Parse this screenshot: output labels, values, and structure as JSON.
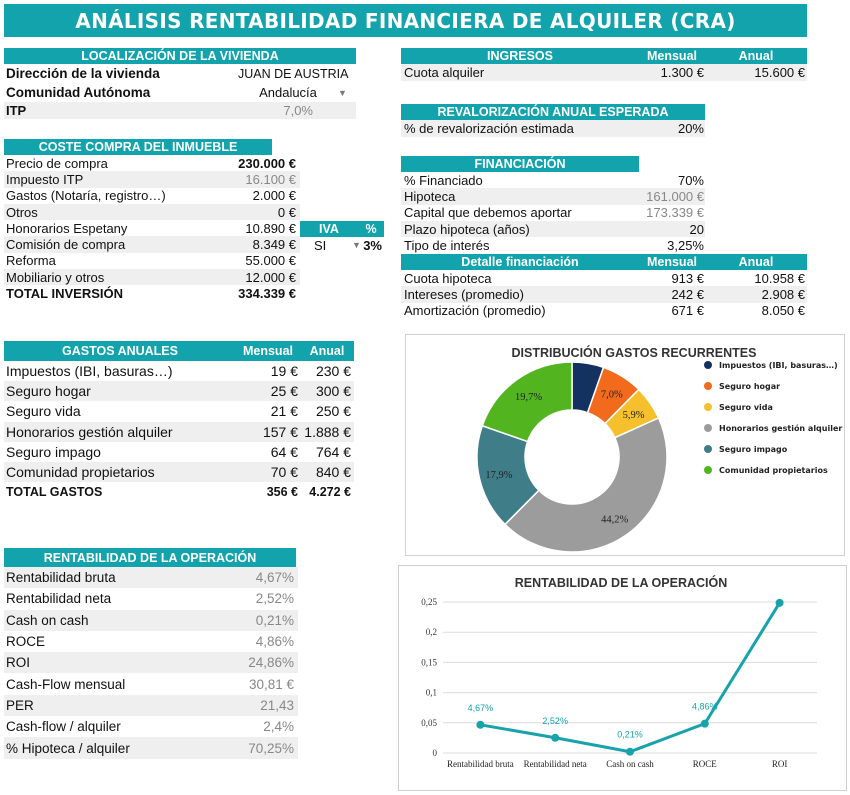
{
  "title": "ANÁLISIS RENTABILIDAD FINANCIERA DE ALQUILER (CRA)",
  "localizacion": {
    "header": "LOCALIZACIÓN DE LA VIVIENDA",
    "rows": [
      {
        "label": "Dirección de la vivienda",
        "value": "JUAN DE AUSTRIA"
      },
      {
        "label": "Comunidad Autónoma",
        "value": "Andalucía"
      },
      {
        "label": "ITP",
        "value": "7,0%"
      }
    ],
    "dropdown_icon": "dropdown-arrow-icon"
  },
  "coste": {
    "header": "COSTE COMPRA DEL INMUEBLE",
    "rows": [
      {
        "label": "Precio de compra",
        "value": "230.000 €"
      },
      {
        "label": "Impuesto ITP",
        "value": "16.100 €"
      },
      {
        "label": "Gastos (Notaría, registro…)",
        "value": "2.000 €"
      },
      {
        "label": "Otros",
        "value": "0 €"
      },
      {
        "label": "Honorarios Espetany",
        "value": "10.890 €"
      },
      {
        "label": "Comisión de compra",
        "value": "8.349 €"
      },
      {
        "label": "Reforma",
        "value": "55.000 €"
      },
      {
        "label": "Mobiliario y otros",
        "value": "12.000 €"
      },
      {
        "label": "TOTAL INVERSIÓN",
        "value": "334.339 €"
      }
    ],
    "iva_header": "IVA",
    "pct_header": "%",
    "iva_value": "SI",
    "pct_value": "3%"
  },
  "ingresos": {
    "header": "INGRESOS",
    "col_mensual": "Mensual",
    "col_anual": "Anual",
    "rows": [
      {
        "label": "Cuota alquiler",
        "mensual": "1.300 €",
        "anual": "15.600 €"
      }
    ]
  },
  "revalorizacion": {
    "header": "REVALORIZACIÓN ANUAL ESPERADA",
    "label": "% de revalorización estimada",
    "value": "20%"
  },
  "financiacion": {
    "header": "FINANCIACIÓN",
    "rows": [
      {
        "label": "% Financiado",
        "value": "70%"
      },
      {
        "label": "Hipoteca",
        "value": "161.000 €"
      },
      {
        "label": "Capital que debemos aportar",
        "value": "173.339 €"
      },
      {
        "label": "Plazo hipoteca (años)",
        "value": "20"
      },
      {
        "label": "Tipo de interés",
        "value": "3,25%"
      }
    ]
  },
  "detalle": {
    "header": "Detalle financiación",
    "col_mensual": "Mensual",
    "col_anual": "Anual",
    "rows": [
      {
        "label": "Cuota hipoteca",
        "mensual": "913 €",
        "anual": "10.958 €"
      },
      {
        "label": "Intereses (promedio)",
        "mensual": "242 €",
        "anual": "2.908 €"
      },
      {
        "label": "Amortización (promedio)",
        "mensual": "671 €",
        "anual": "8.050 €"
      }
    ]
  },
  "gastos": {
    "header": "GASTOS ANUALES",
    "col_mensual": "Mensual",
    "col_anual": "Anual",
    "rows": [
      {
        "label": "Impuestos (IBI, basuras…)",
        "mensual": "19 €",
        "anual": "230 €"
      },
      {
        "label": "Seguro hogar",
        "mensual": "25 €",
        "anual": "300 €"
      },
      {
        "label": "Seguro vida",
        "mensual": "21 €",
        "anual": "250 €"
      },
      {
        "label": "Honorarios gestión alquiler",
        "mensual": "157 €",
        "anual": "1.888 €"
      },
      {
        "label": "Seguro impago",
        "mensual": "64 €",
        "anual": "764 €"
      },
      {
        "label": "Comunidad propietarios",
        "mensual": "70 €",
        "anual": "840 €"
      },
      {
        "label": "TOTAL GASTOS",
        "mensual": "356 €",
        "anual": "4.272 €"
      }
    ]
  },
  "rentabilidad": {
    "header": "RENTABILIDAD DE LA OPERACIÓN",
    "rows": [
      {
        "label": "Rentabilidad bruta",
        "value": "4,67%"
      },
      {
        "label": "Rentabilidad neta",
        "value": "2,52%"
      },
      {
        "label": "Cash on cash",
        "value": "0,21%"
      },
      {
        "label": "ROCE",
        "value": "4,86%"
      },
      {
        "label": "ROI",
        "value": "24,86%"
      },
      {
        "label": "Cash-Flow mensual",
        "value": "30,81 €"
      },
      {
        "label": "PER",
        "value": "21,43"
      },
      {
        "label": "Cash-flow / alquiler",
        "value": "2,4%"
      },
      {
        "label": "% Hipoteca / alquiler",
        "value": "70,25%"
      }
    ]
  },
  "chart_data": [
    {
      "type": "pie",
      "title": "DISTRIBUCIÓN GASTOS RECURRENTES",
      "categories": [
        "Impuestos (IBI, basuras…)",
        "Seguro hogar",
        "Seguro vida",
        "Honorarios gestión alquiler",
        "Seguro impago",
        "Comunidad propietarios"
      ],
      "values": [
        230,
        300,
        250,
        1888,
        764,
        840
      ],
      "labels": [
        "",
        "7,0%",
        "5,9%",
        "44,2%",
        "17,9%",
        "19,7%"
      ],
      "colors": [
        "#13325f",
        "#f26a1b",
        "#f6c02d",
        "#9c9c9c",
        "#3f7e89",
        "#52b51f"
      ],
      "donut": true,
      "legend": "right"
    },
    {
      "type": "line",
      "title": "RENTABILIDAD DE LA OPERACIÓN",
      "categories": [
        "Rentabilidad bruta",
        "Rentabilidad neta",
        "Cash on cash",
        "ROCE",
        "ROI"
      ],
      "values": [
        0.0467,
        0.0252,
        0.0021,
        0.0486,
        0.2486
      ],
      "data_labels": [
        "4,67%",
        "2,52%",
        "0,21%",
        "4,86%",
        ""
      ],
      "yticks": [
        "0",
        "0,05",
        "0,1",
        "0,15",
        "0,2",
        "0,25"
      ],
      "ylim": [
        0,
        0.25
      ],
      "color": "#17a2ac",
      "grid": true
    }
  ]
}
